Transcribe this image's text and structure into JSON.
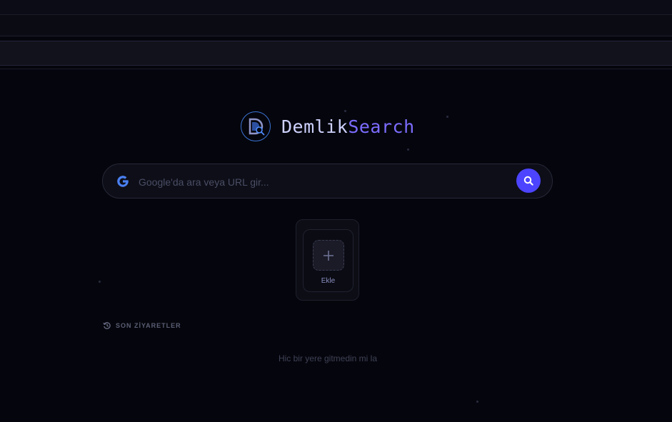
{
  "logo": {
    "name_part1": "Demlik",
    "name_part2": "Search",
    "colors": {
      "ring": "#3b73d6",
      "part1": "#cfd2ff",
      "part2": "#7c6cff"
    }
  },
  "search": {
    "placeholder": "Google'da ara veya URL gir...",
    "value": "",
    "engine_icon": "google-g-icon",
    "button_icon": "search-icon",
    "button_color": "#4c44ff"
  },
  "shortcuts": {
    "add_label": "Ekle",
    "add_icon": "plus-icon"
  },
  "recent": {
    "icon": "history-icon",
    "title": "SON ZİYARETLER",
    "empty_message": "Hic bir yere gitmedin mi la"
  }
}
